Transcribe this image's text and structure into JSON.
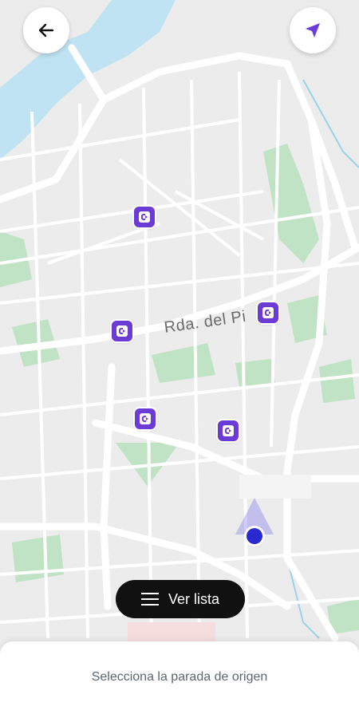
{
  "map": {
    "street_label": "Rda. del Pi",
    "colors": {
      "water": "#bfe3f2",
      "park": "#bfe3c4",
      "road": "#ffffff",
      "background": "#ececec",
      "stop_marker": "#6c3bd6",
      "user_location": "#2a2ad0"
    }
  },
  "header": {
    "back_icon": "arrow-left-icon",
    "locate_icon": "navigation-arrow-icon"
  },
  "stops": [
    {
      "name": "stop-marker-1",
      "icon": "bus-stop-icon"
    },
    {
      "name": "stop-marker-2",
      "icon": "bus-stop-icon"
    },
    {
      "name": "stop-marker-3",
      "icon": "bus-stop-icon"
    },
    {
      "name": "stop-marker-4",
      "icon": "bus-stop-icon"
    },
    {
      "name": "stop-marker-5",
      "icon": "bus-stop-icon"
    }
  ],
  "list_button": {
    "label": "Ver lista",
    "icon": "list-icon"
  },
  "bottom_sheet": {
    "prompt": "Selecciona la parada de origen"
  }
}
